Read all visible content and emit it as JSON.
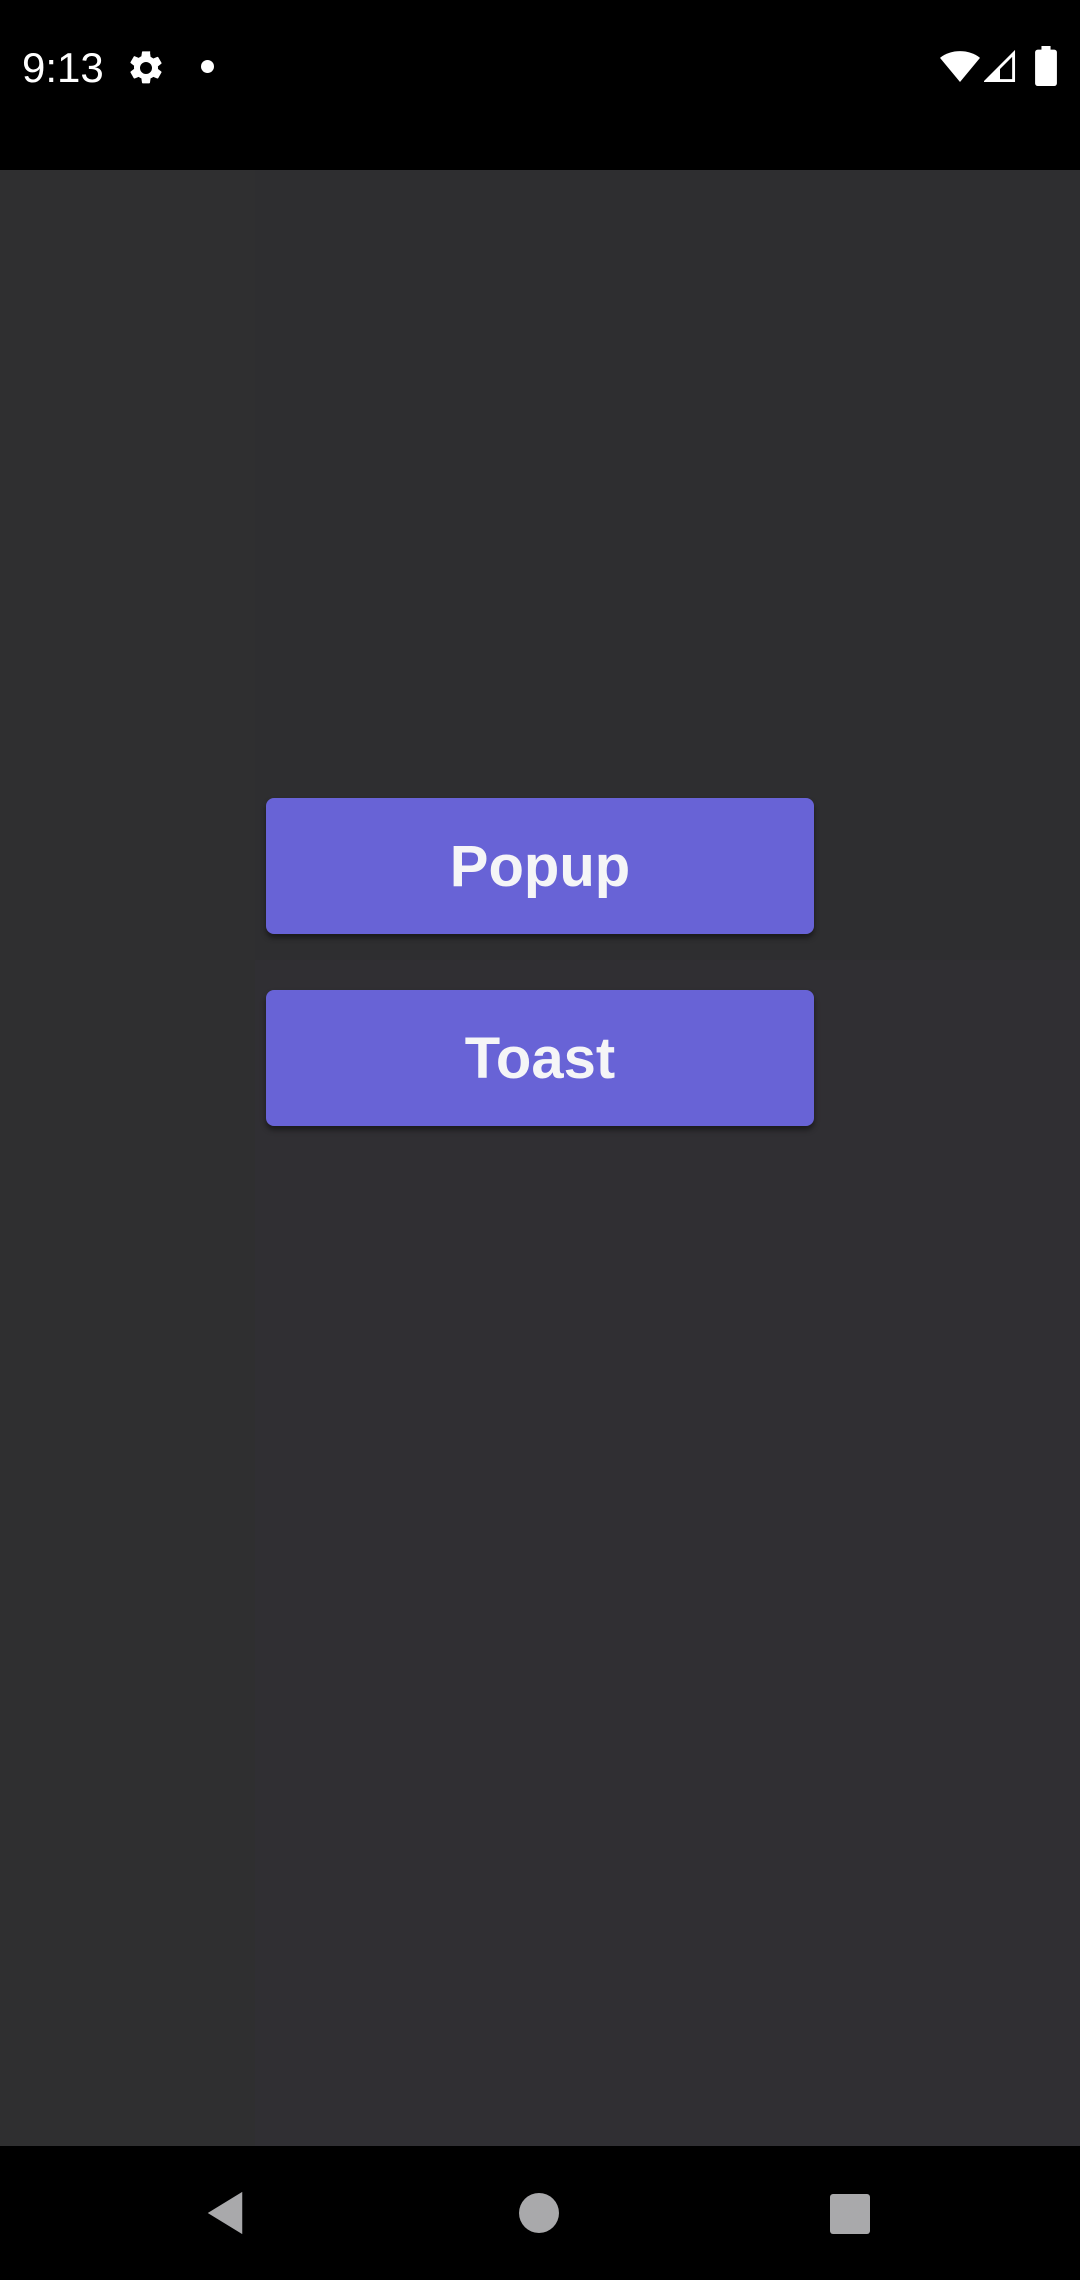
{
  "status_bar": {
    "time": "9:13",
    "icons": [
      "settings-icon",
      "notification-dot-icon",
      "wifi-icon",
      "signal-icon",
      "battery-icon"
    ]
  },
  "main": {
    "buttons": {
      "popup_label": "Popup",
      "toast_label": "Toast"
    }
  },
  "nav_bar": {
    "icons": [
      "back-icon",
      "home-icon",
      "recents-icon"
    ]
  },
  "colors": {
    "background": "#2e2e30",
    "button": "#6863d6",
    "button_text": "#f5f5f7",
    "status_bar": "#000000",
    "nav_icon": "#a9a9ab"
  }
}
